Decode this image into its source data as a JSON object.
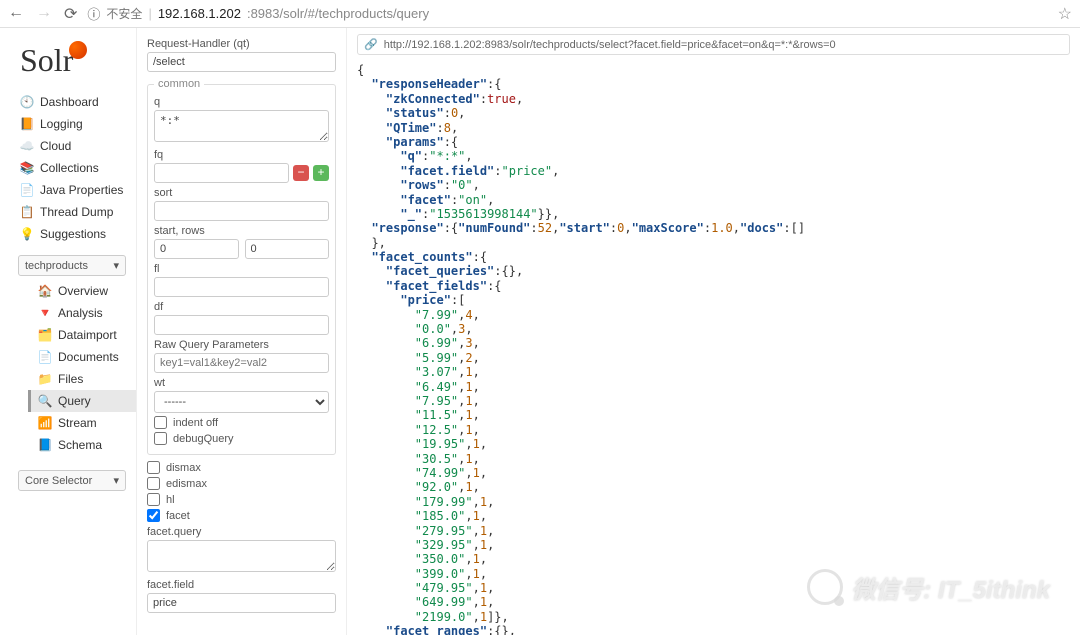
{
  "browser": {
    "insecure_label": "不安全",
    "host": "192.168.1.202",
    "port_path": ":8983/solr/#/techproducts/query"
  },
  "logo": "Solr",
  "nav": {
    "dashboard": "Dashboard",
    "logging": "Logging",
    "cloud": "Cloud",
    "collections": "Collections",
    "java_props": "Java Properties",
    "thread_dump": "Thread Dump",
    "suggestions": "Suggestions"
  },
  "core_selected": "techproducts",
  "core_selector_label": "Core Selector",
  "subnav": {
    "overview": "Overview",
    "analysis": "Analysis",
    "dataimport": "Dataimport",
    "documents": "Documents",
    "files": "Files",
    "query": "Query",
    "stream": "Stream",
    "schema": "Schema"
  },
  "form": {
    "qt_label": "Request-Handler (qt)",
    "qt_value": "/select",
    "common_legend": "common",
    "q_label": "q",
    "q_value": "*:*",
    "fq_label": "fq",
    "sort_label": "sort",
    "start_rows_label": "start, rows",
    "start_value": "0",
    "rows_value": "0",
    "fl_label": "fl",
    "df_label": "df",
    "raw_label": "Raw Query Parameters",
    "raw_placeholder": "key1=val1&key2=val2",
    "wt_label": "wt",
    "wt_value": "------",
    "indent_off": "indent off",
    "debug_query": "debugQuery",
    "dismax": "dismax",
    "edismax": "edismax",
    "hl": "hl",
    "facet": "facet",
    "facet_query_label": "facet.query",
    "facet_field_label": "facet.field",
    "facet_field_value": "price"
  },
  "result": {
    "url": "http://192.168.1.202:8983/solr/techproducts/select?facet.field=price&facet=on&q=*:*&rows=0"
  },
  "json_response": {
    "responseHeader": {
      "zkConnected": true,
      "status": 0,
      "QTime": 8,
      "params": {
        "q": "*:*",
        "facet.field": "price",
        "rows": "0",
        "facet": "on",
        "_": "1535613998144"
      }
    },
    "response": {
      "numFound": 52,
      "start": 0,
      "maxScore": 1.0,
      "docs": []
    },
    "facet_counts": {
      "facet_queries": {},
      "facet_fields": {
        "price": [
          [
            "7.99",
            4
          ],
          [
            "0.0",
            3
          ],
          [
            "6.99",
            3
          ],
          [
            "5.99",
            2
          ],
          [
            "3.07",
            1
          ],
          [
            "6.49",
            1
          ],
          [
            "7.95",
            1
          ],
          [
            "11.5",
            1
          ],
          [
            "12.5",
            1
          ],
          [
            "19.95",
            1
          ],
          [
            "30.5",
            1
          ],
          [
            "74.99",
            1
          ],
          [
            "92.0",
            1
          ],
          [
            "179.99",
            1
          ],
          [
            "185.0",
            1
          ],
          [
            "279.95",
            1
          ],
          [
            "329.95",
            1
          ],
          [
            "350.0",
            1
          ],
          [
            "399.0",
            1
          ],
          [
            "479.95",
            1
          ],
          [
            "649.99",
            1
          ],
          [
            "2199.0",
            1
          ]
        ]
      },
      "facet_ranges": {}
    }
  },
  "watermark": "微信号: IT_5ithink"
}
